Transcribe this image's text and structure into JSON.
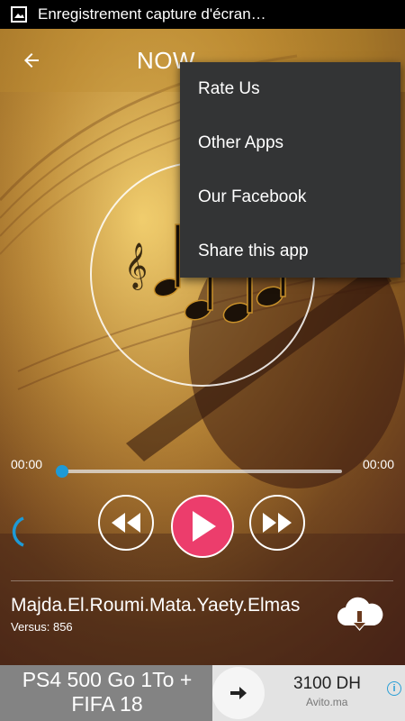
{
  "status_bar": {
    "text": "Enregistrement capture d'écran…",
    "icon": "screenshot-icon"
  },
  "toolbar": {
    "title": "NOW",
    "back_icon": "arrow-left-icon"
  },
  "player": {
    "elapsed": "00:00",
    "duration": "00:00",
    "progress": 0
  },
  "track": {
    "title": "Majda.El.Roumi.Mata.Yaety.Elmas",
    "subtitle": "Versus: 856"
  },
  "menu": {
    "items": [
      "Rate Us",
      "Other Apps",
      "Our Facebook",
      "Share this app"
    ]
  },
  "ad": {
    "text": "PS4 500 Go 1To + FIFA 18",
    "price": "3100 DH",
    "source": "Avito.ma"
  },
  "colors": {
    "play_button": "#ec3d6c",
    "seek_thumb": "#1e9ad6",
    "menu_bg": "#333435"
  }
}
